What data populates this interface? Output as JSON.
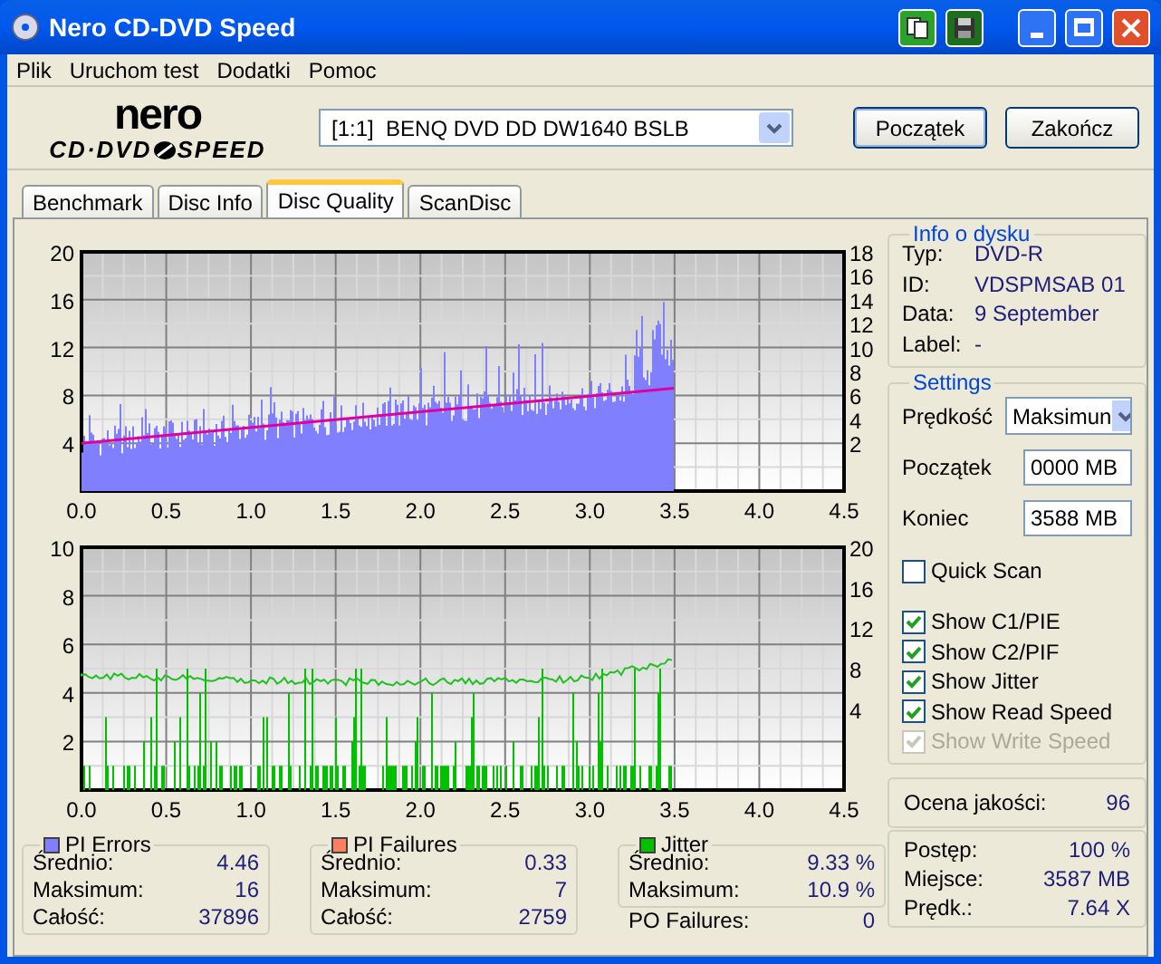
{
  "window": {
    "title": "Nero CD-DVD Speed"
  },
  "menu": [
    "Plik",
    "Uruchom test",
    "Dodatki",
    "Pomoc"
  ],
  "logo": {
    "brand": "nero",
    "line_left": "CD·DVD",
    "line_right": "SPEED"
  },
  "drive": {
    "value": "[1:1]  BENQ DVD DD DW1640 BSLB"
  },
  "toolbar_buttons": [
    "Początek",
    "Zakończ"
  ],
  "tabs": [
    {
      "label": "Benchmark",
      "selected": false
    },
    {
      "label": "Disc Info",
      "selected": false
    },
    {
      "label": "Disc Quality",
      "selected": true
    },
    {
      "label": "ScanDisc",
      "selected": false
    }
  ],
  "charts": [
    {
      "left_ticks": [
        "20",
        "16",
        "12",
        "8",
        "4"
      ],
      "right_ticks": [
        "18",
        "16",
        "14",
        "12",
        "10",
        "8",
        "6",
        "4",
        "2"
      ],
      "x_ticks": [
        "0.0",
        "0.5",
        "1.0",
        "1.5",
        "2.0",
        "2.5",
        "3.0",
        "3.5",
        "4.0",
        "4.5"
      ]
    },
    {
      "left_ticks": [
        "10",
        "8",
        "6",
        "4",
        "2"
      ],
      "right_ticks": [
        "20",
        "16",
        "12",
        "8",
        "4"
      ],
      "x_ticks": [
        "0.0",
        "0.5",
        "1.0",
        "1.5",
        "2.0",
        "2.5",
        "3.0",
        "3.5",
        "4.0",
        "4.5"
      ]
    }
  ],
  "stats": [
    {
      "title": "PI Errors",
      "color": "#8080ff",
      "rows": [
        {
          "label": "Średnio:",
          "value": "4.46"
        },
        {
          "label": "Maksimum:",
          "value": "16"
        },
        {
          "label": "Całość:",
          "value": "37896"
        }
      ]
    },
    {
      "title": "PI Failures",
      "color": "#ff8060",
      "rows": [
        {
          "label": "Średnio:",
          "value": "0.33"
        },
        {
          "label": "Maksimum:",
          "value": "7"
        },
        {
          "label": "Całość:",
          "value": "2759"
        }
      ]
    },
    {
      "title": "Jitter",
      "color": "#00c000",
      "rows": [
        {
          "label": "Średnio:",
          "value": "9.33 %"
        },
        {
          "label": "Maksimum:",
          "value": "10.9 %"
        }
      ]
    }
  ],
  "po_failures": {
    "label": "PO Failures:",
    "value": "0"
  },
  "disc_info": {
    "title": "Info o dysku",
    "rows": [
      {
        "label": "Typ:",
        "value": "DVD-R"
      },
      {
        "label": "ID:",
        "value": "VDSPMSAB 01"
      },
      {
        "label": "Data:",
        "value": "9 September"
      },
      {
        "label": "Label:",
        "value": "-"
      }
    ]
  },
  "settings": {
    "title": "Settings",
    "speed": {
      "label": "Prędkość",
      "value": "Maksimun"
    },
    "start": {
      "label": "Początek",
      "value": "0000 MB"
    },
    "end": {
      "label": "Koniec",
      "value": "3588 MB"
    },
    "quick_scan": {
      "label": "Quick Scan",
      "checked": false
    },
    "show_options": [
      {
        "label": "Show C1/PIE",
        "checked": true,
        "disabled": false
      },
      {
        "label": "Show C2/PIF",
        "checked": true,
        "disabled": false
      },
      {
        "label": "Show Jitter",
        "checked": true,
        "disabled": false
      },
      {
        "label": "Show Read Speed",
        "checked": true,
        "disabled": false
      },
      {
        "label": "Show Write Speed",
        "checked": true,
        "disabled": true
      }
    ]
  },
  "quality": {
    "label": "Ocena jakości:",
    "value": "96"
  },
  "progress": [
    {
      "label": "Postęp:",
      "value": "100 %"
    },
    {
      "label": "Miejsce:",
      "value": "3587 MB"
    },
    {
      "label": "Prędk.:",
      "value": "7.64 X"
    }
  ]
}
